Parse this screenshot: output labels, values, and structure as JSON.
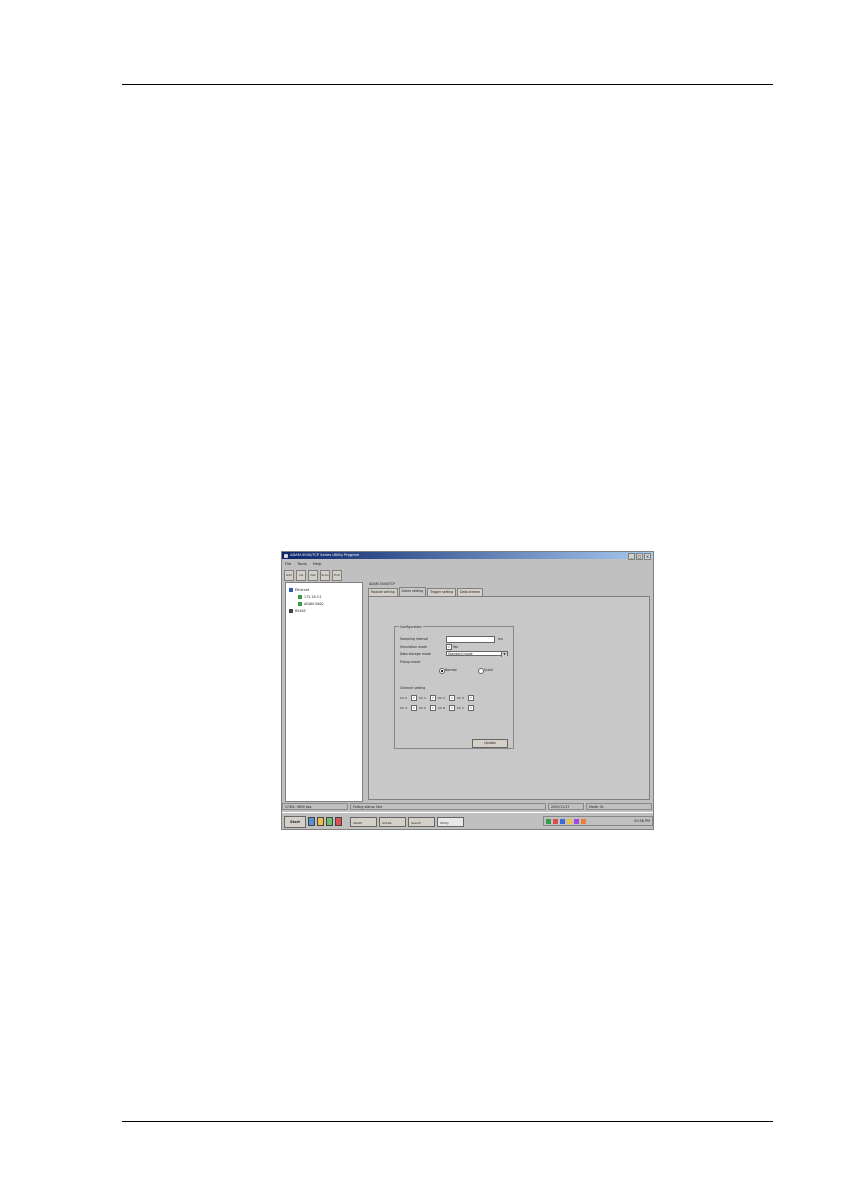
{
  "window": {
    "title": "ADAM-5000/TCP Series Utility Program",
    "menu": [
      "File",
      "Tools",
      "Help"
    ],
    "toolbar": [
      "Add",
      "Ins",
      "Del",
      "Scan",
      "Exit"
    ]
  },
  "tree": {
    "items": [
      {
        "label": "Ethernet",
        "level": 1
      },
      {
        "label": "172.18.3.1",
        "level": 2
      },
      {
        "label": "ADAM-5000",
        "level": 2
      },
      {
        "label": "RS485",
        "level": 1
      }
    ]
  },
  "panel": {
    "label": "ADAM-5000/TCP",
    "tabs": [
      "Module setting",
      "Alarm setting",
      "Trigger setting",
      "Data stream"
    ],
    "active_tab": 1
  },
  "config": {
    "group_title": "Configuration",
    "sampling_interval_label": "Sampling interval",
    "sampling_interval_value": "",
    "sampling_interval_unit": "ms",
    "simulation_mode_label": "Simulation mode",
    "simulation_checkbox_label": "Yes",
    "data_storage_mode_label": "Data storage mode",
    "data_storage_mode_value": "Standard mode",
    "pickup_mode_label": "Pickup mode",
    "pickup_options": [
      "Normal",
      "Quick"
    ],
    "pickup_selected": 0,
    "channel_setting_label": "Channel setting",
    "channels_row1": [
      "Ch 0",
      "Ch 1",
      "Ch 2",
      "Ch 3"
    ],
    "channels_row2": [
      "Ch 4",
      "Ch 5",
      "Ch 6",
      "Ch 7"
    ],
    "update_button": "Update"
  },
  "statusbar": {
    "left": "COM1: 9600 bps",
    "middle": "Polling status: Idle",
    "right1": "2002/11/17",
    "right2": "Mode: OL"
  },
  "taskbar": {
    "start": "Start",
    "tasks": [
      "ADAM",
      "Adobe",
      "Search",
      "Utility"
    ],
    "clock": "09:58 PM"
  }
}
